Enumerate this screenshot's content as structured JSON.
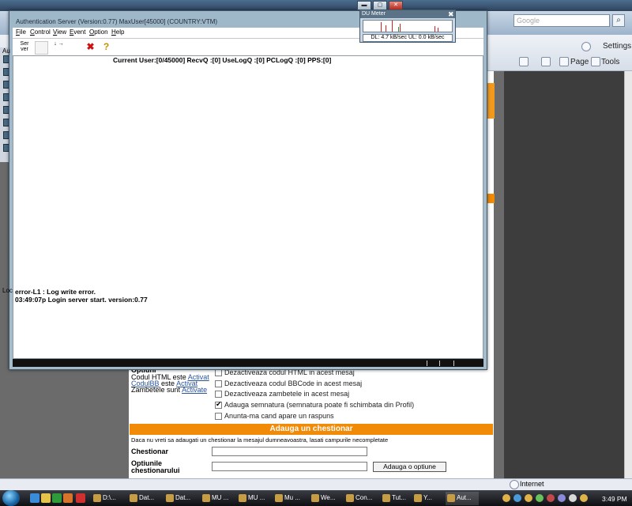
{
  "browser": {
    "search_placeholder": "Google",
    "settings_label": "Settings",
    "page_label": "Page",
    "tools_label": "Tools",
    "status_zone": "Internet"
  },
  "form": {
    "options_heading": "Optiuni",
    "html_label": "Codul HTML este",
    "html_value": "Activat",
    "bbcode_label": "CodulBB",
    "bbcode_mid": "este",
    "bbcode_value": "Activat",
    "smilies_label": "Zambetele sunt",
    "smilies_value": "Activate",
    "checkboxes": [
      {
        "label": "Dezactiveaza codul HTML in acest mesaj",
        "checked": false
      },
      {
        "label": "Dezactiveaza codul BBCode in acest mesaj",
        "checked": false
      },
      {
        "label": "Dezactiveaza zambetele in acest mesaj",
        "checked": false
      },
      {
        "label": "Adauga semnatura (semnatura poate fi schimbata din Profil)",
        "checked": true
      },
      {
        "label": "Anunta-ma cand apare un raspuns",
        "checked": false
      }
    ],
    "poll_header": "Adauga un chestionar",
    "poll_hint": "Daca nu vreti sa adaugati un chestionar la mesajul dumneavoastra, lasati campurile necompletate",
    "poll_question_label": "Chestionar",
    "poll_options_label_1": "Optiunile",
    "poll_options_label_2": "chestionarului",
    "add_option_button": "Adauga o optiune"
  },
  "auth_window": {
    "title": "Authentication Server (Version:0.77) MaxUser[45000] (COUNTRY:VTM)",
    "menu": [
      "File",
      "Control",
      "View",
      "Event",
      "Option",
      "Help"
    ],
    "toolbar": {
      "btn1": "Ser ver",
      "btn3": "↓ →",
      "close_x": "✖",
      "help": "?"
    },
    "status_line": "Current User:[0/45000] RecvQ :[0] UseLogQ :[0] PCLogQ :[0] PPS:[0]",
    "log_lines": [
      "error-L1 : Log write error.",
      "03:49:07p Login server start. version:0.77"
    ],
    "side_label_top": "Au",
    "side_label_bottom": "Loc"
  },
  "du_meter": {
    "title": "DU Meter",
    "close": "✖",
    "readout": "DL: 4.7 kB/sec  UL: 0.0 kB/sec",
    "download_color": "#d42020",
    "upload_color": "#20a030"
  },
  "taskbar": {
    "buttons": [
      "D:\\...",
      "Dat...",
      "Dat...",
      "MU ...",
      "MU ...",
      "Mu ...",
      "We...",
      "Con...",
      "Tut...",
      "Y...",
      "Aut..."
    ],
    "clock": "3:49 PM"
  }
}
